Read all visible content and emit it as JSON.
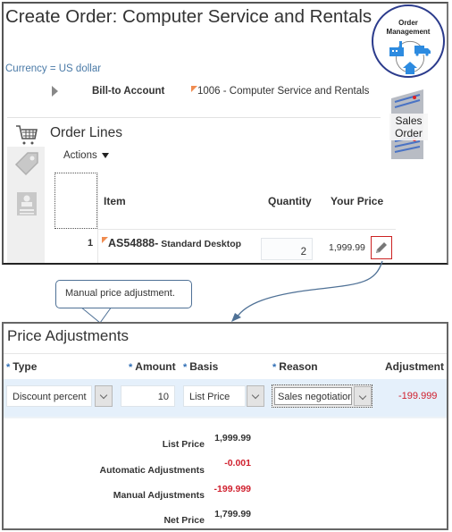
{
  "order": {
    "title": "Create Order: Computer Service and Rentals",
    "currency": "Currency = US dollar",
    "bill_to_label": "Bill-to Account",
    "bill_to_value": "1006 - Computer Service and Rentals"
  },
  "badges": {
    "order_management_line1": "Order",
    "order_management_line2": "Management",
    "sales_order_line1": "Sales",
    "sales_order_line2": "Order"
  },
  "order_lines": {
    "title": "Order Lines",
    "actions_label": "Actions",
    "columns": [
      "Item",
      "Quantity",
      "Your Price"
    ],
    "rows": [
      {
        "line": "1",
        "item_code": "AS54888-",
        "item_desc": " Standard Desktop",
        "quantity": "2",
        "your_price": "1,999.99"
      }
    ]
  },
  "callout": {
    "text": "Manual price adjustment."
  },
  "price_adjustments": {
    "title": "Price Adjustments",
    "required_marker": "*",
    "columns": {
      "type": "Type",
      "amount": "Amount",
      "basis": "Basis",
      "reason": "Reason",
      "adjustment": "Adjustment"
    },
    "row": {
      "type": "Discount percent",
      "amount": "10",
      "basis": "List Price",
      "reason": "Sales negotiation",
      "adjustment": "-199.999"
    },
    "summary": [
      {
        "label": "List Price",
        "value": "1,999.99",
        "negative": false
      },
      {
        "label": "Automatic Adjustments",
        "value": "-0.001",
        "negative": true
      },
      {
        "label": "Manual Adjustments",
        "value": "-199.999",
        "negative": true
      },
      {
        "label": "Net Price",
        "value": "1,799.99",
        "negative": false
      }
    ]
  },
  "colors": {
    "accent_blue": "#2e6db4",
    "negative_red": "#d0202e",
    "highlight_red": "#cc2222",
    "row_highlight": "#e5f0fb"
  }
}
